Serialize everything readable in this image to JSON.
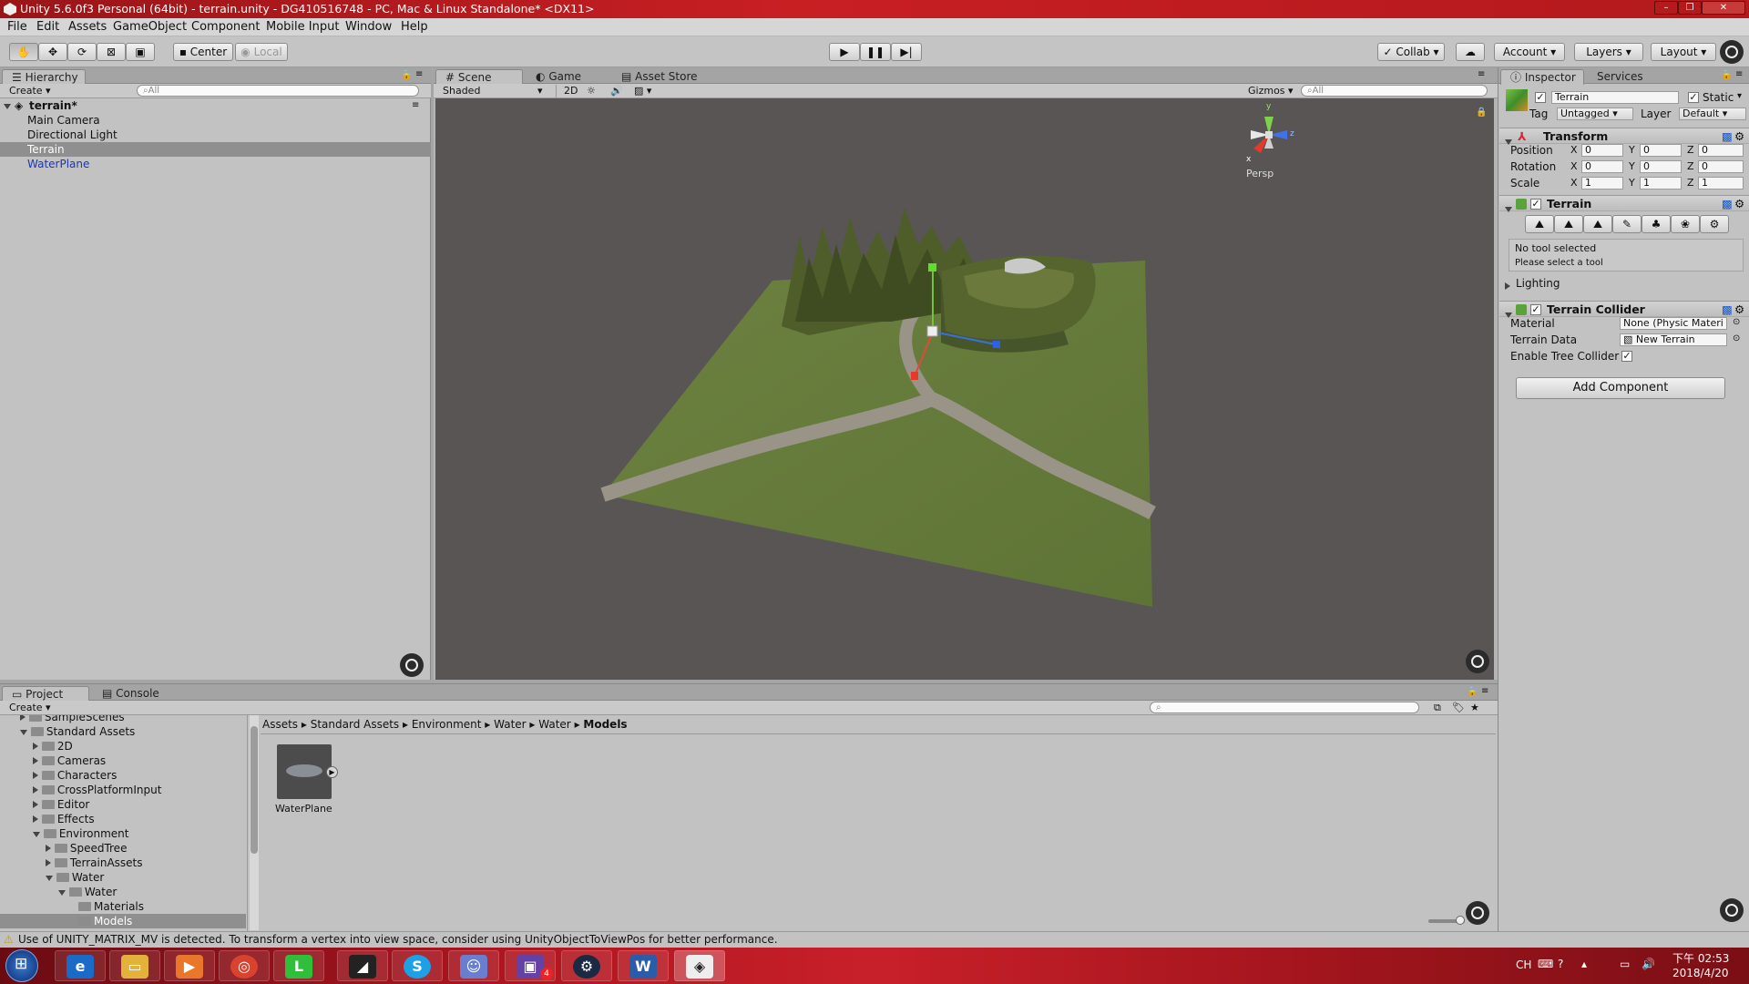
{
  "window": {
    "title": "Unity 5.6.0f3 Personal (64bit) - terrain.unity - DG410516748 - PC, Mac & Linux Standalone* <DX11>"
  },
  "menu": [
    "File",
    "Edit",
    "Assets",
    "GameObject",
    "Component",
    "Mobile Input",
    "Window",
    "Help"
  ],
  "toolbar": {
    "pivot_center": "Center",
    "pivot_local": "Local",
    "collab": "Collab",
    "account": "Account",
    "layers": "Layers",
    "layout": "Layout"
  },
  "hierarchy": {
    "tab": "Hierarchy",
    "create": "Create",
    "search_placeholder": "All",
    "scene_name": "terrain*",
    "items": [
      {
        "label": "Main Camera"
      },
      {
        "label": "Directional Light"
      },
      {
        "label": "Terrain"
      },
      {
        "label": "WaterPlane"
      }
    ]
  },
  "scene": {
    "tabs": [
      "Scene",
      "Game",
      "Asset Store"
    ],
    "shading": "Shaded",
    "mode_2d": "2D",
    "gizmos": "Gizmos",
    "search_placeholder": "All",
    "persp": "Persp",
    "axis_y": "y",
    "axis_z": "z",
    "axis_x": "x"
  },
  "inspector": {
    "tabs": [
      "Inspector",
      "Services"
    ],
    "object_name": "Terrain",
    "static_label": "Static",
    "tag_label": "Tag",
    "tag_value": "Untagged",
    "layer_label": "Layer",
    "layer_value": "Default",
    "transform": {
      "header": "Transform",
      "rows": [
        {
          "label": "Position",
          "x": "0",
          "y": "0",
          "z": "0"
        },
        {
          "label": "Rotation",
          "x": "0",
          "y": "0",
          "z": "0"
        },
        {
          "label": "Scale",
          "x": "1",
          "y": "1",
          "z": "1"
        }
      ],
      "axis_x": "X",
      "axis_y": "Y",
      "axis_z": "Z"
    },
    "terrain": {
      "header": "Terrain",
      "no_tool": "No tool selected",
      "select_tool": "Please select a tool"
    },
    "lighting": "Lighting",
    "collider": {
      "header": "Terrain Collider",
      "material_label": "Material",
      "material_value": "None (Physic Materi",
      "data_label": "Terrain Data",
      "data_value": "New Terrain",
      "tree_label": "Enable Tree Collider"
    },
    "add_component": "Add Component"
  },
  "project": {
    "tabs": [
      "Project",
      "Console"
    ],
    "create": "Create",
    "tree": [
      {
        "label": "SampleScenes",
        "depth": 1,
        "open": false
      },
      {
        "label": "Standard Assets",
        "depth": 1,
        "open": true
      },
      {
        "label": "2D",
        "depth": 2,
        "open": false
      },
      {
        "label": "Cameras",
        "depth": 2,
        "open": false
      },
      {
        "label": "Characters",
        "depth": 2,
        "open": false
      },
      {
        "label": "CrossPlatformInput",
        "depth": 2,
        "open": false
      },
      {
        "label": "Editor",
        "depth": 2,
        "open": false
      },
      {
        "label": "Effects",
        "depth": 2,
        "open": false
      },
      {
        "label": "Environment",
        "depth": 2,
        "open": true
      },
      {
        "label": "SpeedTree",
        "depth": 3,
        "open": false
      },
      {
        "label": "TerrainAssets",
        "depth": 3,
        "open": false
      },
      {
        "label": "Water",
        "depth": 3,
        "open": true
      },
      {
        "label": "Water",
        "depth": 4,
        "open": true
      },
      {
        "label": "Materials",
        "depth": 5,
        "open": null
      },
      {
        "label": "Models",
        "depth": 5,
        "open": null
      }
    ],
    "breadcrumb": [
      "Assets",
      "Standard Assets",
      "Environment",
      "Water",
      "Water",
      "Models"
    ],
    "asset_name": "WaterPlane"
  },
  "status": {
    "message": "Use of UNITY_MATRIX_MV is detected. To transform a vertex into view space, consider using UnityObjectToViewPos for better performance."
  },
  "taskbar": {
    "ime": "CH",
    "time": "下午 02:53",
    "date": "2018/4/20",
    "apps": [
      "start",
      "internet-explorer",
      "file-explorer",
      "media-player",
      "chrome",
      "line",
      "blender",
      "skype",
      "discord",
      "twitch",
      "steam",
      "word",
      "unity"
    ],
    "twitch_badge": "4"
  }
}
